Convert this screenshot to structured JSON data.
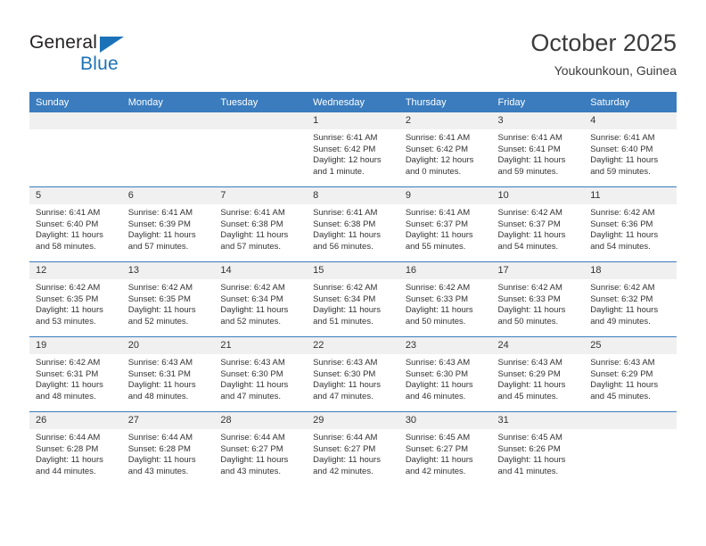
{
  "brand": {
    "name_top": "General",
    "name_bottom": "Blue",
    "accent_color": "#1b72b8"
  },
  "header": {
    "title": "October 2025",
    "subtitle": "Youkounkoun, Guinea"
  },
  "theme": {
    "header_blue": "#3a7cbe",
    "daynum_bg": "#f0f0f0",
    "text": "#333333"
  },
  "weekday_headers": [
    "Sunday",
    "Monday",
    "Tuesday",
    "Wednesday",
    "Thursday",
    "Friday",
    "Saturday"
  ],
  "weeks": [
    [
      {
        "day": "",
        "blank": true,
        "sunrise": "",
        "sunset": "",
        "daylight1": "",
        "daylight2": ""
      },
      {
        "day": "",
        "blank": true,
        "sunrise": "",
        "sunset": "",
        "daylight1": "",
        "daylight2": ""
      },
      {
        "day": "",
        "blank": true,
        "sunrise": "",
        "sunset": "",
        "daylight1": "",
        "daylight2": ""
      },
      {
        "day": "1",
        "sunrise": "Sunrise: 6:41 AM",
        "sunset": "Sunset: 6:42 PM",
        "daylight1": "Daylight: 12 hours",
        "daylight2": "and 1 minute."
      },
      {
        "day": "2",
        "sunrise": "Sunrise: 6:41 AM",
        "sunset": "Sunset: 6:42 PM",
        "daylight1": "Daylight: 12 hours",
        "daylight2": "and 0 minutes."
      },
      {
        "day": "3",
        "sunrise": "Sunrise: 6:41 AM",
        "sunset": "Sunset: 6:41 PM",
        "daylight1": "Daylight: 11 hours",
        "daylight2": "and 59 minutes."
      },
      {
        "day": "4",
        "sunrise": "Sunrise: 6:41 AM",
        "sunset": "Sunset: 6:40 PM",
        "daylight1": "Daylight: 11 hours",
        "daylight2": "and 59 minutes."
      }
    ],
    [
      {
        "day": "5",
        "sunrise": "Sunrise: 6:41 AM",
        "sunset": "Sunset: 6:40 PM",
        "daylight1": "Daylight: 11 hours",
        "daylight2": "and 58 minutes."
      },
      {
        "day": "6",
        "sunrise": "Sunrise: 6:41 AM",
        "sunset": "Sunset: 6:39 PM",
        "daylight1": "Daylight: 11 hours",
        "daylight2": "and 57 minutes."
      },
      {
        "day": "7",
        "sunrise": "Sunrise: 6:41 AM",
        "sunset": "Sunset: 6:38 PM",
        "daylight1": "Daylight: 11 hours",
        "daylight2": "and 57 minutes."
      },
      {
        "day": "8",
        "sunrise": "Sunrise: 6:41 AM",
        "sunset": "Sunset: 6:38 PM",
        "daylight1": "Daylight: 11 hours",
        "daylight2": "and 56 minutes."
      },
      {
        "day": "9",
        "sunrise": "Sunrise: 6:41 AM",
        "sunset": "Sunset: 6:37 PM",
        "daylight1": "Daylight: 11 hours",
        "daylight2": "and 55 minutes."
      },
      {
        "day": "10",
        "sunrise": "Sunrise: 6:42 AM",
        "sunset": "Sunset: 6:37 PM",
        "daylight1": "Daylight: 11 hours",
        "daylight2": "and 54 minutes."
      },
      {
        "day": "11",
        "sunrise": "Sunrise: 6:42 AM",
        "sunset": "Sunset: 6:36 PM",
        "daylight1": "Daylight: 11 hours",
        "daylight2": "and 54 minutes."
      }
    ],
    [
      {
        "day": "12",
        "sunrise": "Sunrise: 6:42 AM",
        "sunset": "Sunset: 6:35 PM",
        "daylight1": "Daylight: 11 hours",
        "daylight2": "and 53 minutes."
      },
      {
        "day": "13",
        "sunrise": "Sunrise: 6:42 AM",
        "sunset": "Sunset: 6:35 PM",
        "daylight1": "Daylight: 11 hours",
        "daylight2": "and 52 minutes."
      },
      {
        "day": "14",
        "sunrise": "Sunrise: 6:42 AM",
        "sunset": "Sunset: 6:34 PM",
        "daylight1": "Daylight: 11 hours",
        "daylight2": "and 52 minutes."
      },
      {
        "day": "15",
        "sunrise": "Sunrise: 6:42 AM",
        "sunset": "Sunset: 6:34 PM",
        "daylight1": "Daylight: 11 hours",
        "daylight2": "and 51 minutes."
      },
      {
        "day": "16",
        "sunrise": "Sunrise: 6:42 AM",
        "sunset": "Sunset: 6:33 PM",
        "daylight1": "Daylight: 11 hours",
        "daylight2": "and 50 minutes."
      },
      {
        "day": "17",
        "sunrise": "Sunrise: 6:42 AM",
        "sunset": "Sunset: 6:33 PM",
        "daylight1": "Daylight: 11 hours",
        "daylight2": "and 50 minutes."
      },
      {
        "day": "18",
        "sunrise": "Sunrise: 6:42 AM",
        "sunset": "Sunset: 6:32 PM",
        "daylight1": "Daylight: 11 hours",
        "daylight2": "and 49 minutes."
      }
    ],
    [
      {
        "day": "19",
        "sunrise": "Sunrise: 6:42 AM",
        "sunset": "Sunset: 6:31 PM",
        "daylight1": "Daylight: 11 hours",
        "daylight2": "and 48 minutes."
      },
      {
        "day": "20",
        "sunrise": "Sunrise: 6:43 AM",
        "sunset": "Sunset: 6:31 PM",
        "daylight1": "Daylight: 11 hours",
        "daylight2": "and 48 minutes."
      },
      {
        "day": "21",
        "sunrise": "Sunrise: 6:43 AM",
        "sunset": "Sunset: 6:30 PM",
        "daylight1": "Daylight: 11 hours",
        "daylight2": "and 47 minutes."
      },
      {
        "day": "22",
        "sunrise": "Sunrise: 6:43 AM",
        "sunset": "Sunset: 6:30 PM",
        "daylight1": "Daylight: 11 hours",
        "daylight2": "and 47 minutes."
      },
      {
        "day": "23",
        "sunrise": "Sunrise: 6:43 AM",
        "sunset": "Sunset: 6:30 PM",
        "daylight1": "Daylight: 11 hours",
        "daylight2": "and 46 minutes."
      },
      {
        "day": "24",
        "sunrise": "Sunrise: 6:43 AM",
        "sunset": "Sunset: 6:29 PM",
        "daylight1": "Daylight: 11 hours",
        "daylight2": "and 45 minutes."
      },
      {
        "day": "25",
        "sunrise": "Sunrise: 6:43 AM",
        "sunset": "Sunset: 6:29 PM",
        "daylight1": "Daylight: 11 hours",
        "daylight2": "and 45 minutes."
      }
    ],
    [
      {
        "day": "26",
        "sunrise": "Sunrise: 6:44 AM",
        "sunset": "Sunset: 6:28 PM",
        "daylight1": "Daylight: 11 hours",
        "daylight2": "and 44 minutes."
      },
      {
        "day": "27",
        "sunrise": "Sunrise: 6:44 AM",
        "sunset": "Sunset: 6:28 PM",
        "daylight1": "Daylight: 11 hours",
        "daylight2": "and 43 minutes."
      },
      {
        "day": "28",
        "sunrise": "Sunrise: 6:44 AM",
        "sunset": "Sunset: 6:27 PM",
        "daylight1": "Daylight: 11 hours",
        "daylight2": "and 43 minutes."
      },
      {
        "day": "29",
        "sunrise": "Sunrise: 6:44 AM",
        "sunset": "Sunset: 6:27 PM",
        "daylight1": "Daylight: 11 hours",
        "daylight2": "and 42 minutes."
      },
      {
        "day": "30",
        "sunrise": "Sunrise: 6:45 AM",
        "sunset": "Sunset: 6:27 PM",
        "daylight1": "Daylight: 11 hours",
        "daylight2": "and 42 minutes."
      },
      {
        "day": "31",
        "sunrise": "Sunrise: 6:45 AM",
        "sunset": "Sunset: 6:26 PM",
        "daylight1": "Daylight: 11 hours",
        "daylight2": "and 41 minutes."
      },
      {
        "day": "",
        "blank": true,
        "sunrise": "",
        "sunset": "",
        "daylight1": "",
        "daylight2": ""
      }
    ]
  ]
}
